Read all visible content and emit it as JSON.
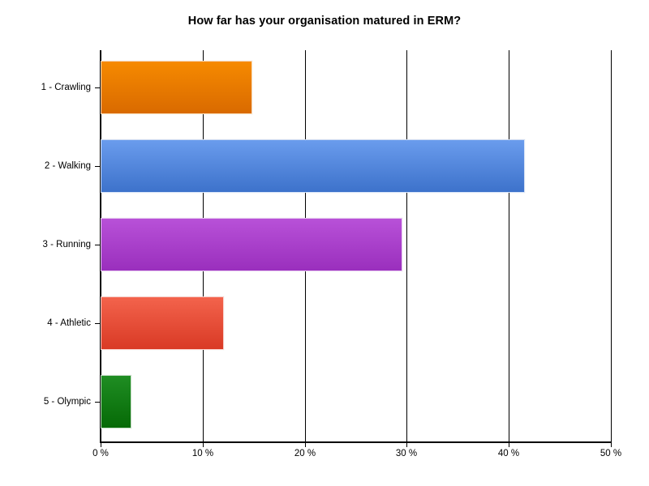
{
  "chart_data": {
    "type": "bar",
    "orientation": "horizontal",
    "title": "How far has your organisation matured in ERM?",
    "xlabel": "",
    "ylabel": "",
    "categories": [
      "1 - Crawling",
      "2 - Walking",
      "3 - Running",
      "4 - Athletic",
      "5 - Olympic"
    ],
    "values": [
      14.9,
      41.6,
      29.6,
      12.1,
      3.0
    ],
    "value_suffix": " %",
    "xlim": [
      0,
      50
    ],
    "xticks": [
      0,
      10,
      20,
      30,
      40,
      50
    ],
    "xtick_labels": [
      "0 %",
      "10 %",
      "20 %",
      "30 %",
      "40 %",
      "50 %"
    ],
    "grid": {
      "vertical": true,
      "horizontal": false
    },
    "legend": {
      "visible": false
    },
    "bar_colors": [
      {
        "name": "orange",
        "top": "#f68a00",
        "bottom": "#d96a00"
      },
      {
        "name": "blue",
        "top": "#6a9ced",
        "bottom": "#3d72cb"
      },
      {
        "name": "purple",
        "top": "#b851d8",
        "bottom": "#9a2fbd"
      },
      {
        "name": "red",
        "top": "#f3634c",
        "bottom": "#d93a25"
      },
      {
        "name": "green",
        "top": "#1f8d23",
        "bottom": "#066a06"
      }
    ],
    "background_color": "#ffffff",
    "axis_color": "#000000",
    "text_color": "#000000"
  }
}
